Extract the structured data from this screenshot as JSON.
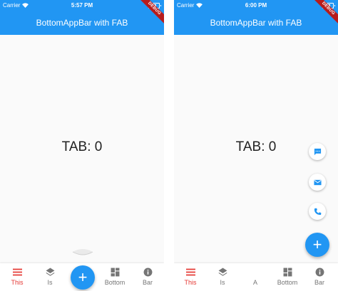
{
  "colors": {
    "app_bar": "#2196f3",
    "active": "#e53935",
    "inactive": "#757575",
    "fab": "#2196f3",
    "debug": "#b71c1c"
  },
  "left_screen": {
    "status": {
      "carrier": "Carrier",
      "time": "5:57 PM"
    },
    "title": "BottomAppBar with FAB",
    "debug_banner": "DEBUG",
    "content": "TAB: 0",
    "fab_icon": "+",
    "nav_items": [
      {
        "label": "This",
        "icon": "menu-icon",
        "active": true
      },
      {
        "label": "Is",
        "icon": "layers-icon",
        "active": false
      },
      {
        "label": "Bottom",
        "icon": "dashboard-icon",
        "active": false
      },
      {
        "label": "Bar",
        "icon": "info-icon",
        "active": false
      }
    ]
  },
  "right_screen": {
    "status": {
      "carrier": "Carrier",
      "time": "6:00 PM"
    },
    "title": "BottomAppBar with FAB",
    "debug_banner": "DEBUG",
    "content": "TAB: 0",
    "fab_icon": "+",
    "mini_fab_icons": [
      "sms-icon",
      "mail-icon",
      "phone-icon"
    ],
    "nav_items": [
      {
        "label": "This",
        "icon": "menu-icon",
        "active": true
      },
      {
        "label": "Is",
        "icon": "layers-icon",
        "active": false
      },
      {
        "label": "A",
        "icon": "",
        "active": false
      },
      {
        "label": "Bottom",
        "icon": "dashboard-icon",
        "active": false
      },
      {
        "label": "Bar",
        "icon": "info-icon",
        "active": false
      }
    ]
  }
}
